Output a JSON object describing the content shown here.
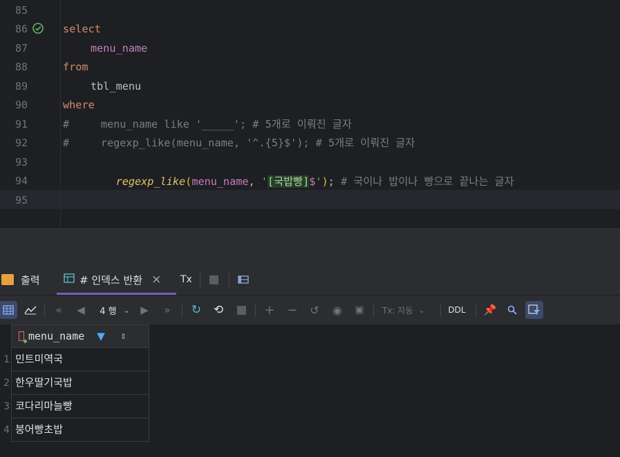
{
  "editor": {
    "line_numbers": [
      "85",
      "86",
      "87",
      "88",
      "89",
      "90",
      "91",
      "92",
      "93",
      "94",
      "95"
    ],
    "lines": {
      "l86": "select",
      "l87": "menu_name",
      "l88": "from",
      "l89": "tbl_menu",
      "l90": "where",
      "l91": "#     menu_name like '_____'; # 5개로 이뤄진 글자",
      "l92": "#     regexp_like(menu_name, '^.{5}$'); # 5개로 이뤄진 글자",
      "l93_fn": "regexp_like",
      "l93_open": "(",
      "l93_col": "menu_name",
      "l93_comma": ", ",
      "l93_q1": "'",
      "l93_regex": "[국밥빵]",
      "l93_end": "$",
      "l93_q2": "'",
      "l93_close": ")",
      "l93_semi": ";",
      "l93_comment": " # 국이나 밥이나 빵으로 끝나는 글자"
    }
  },
  "tabs": {
    "output": "출력",
    "result": "# 인덱스 반환",
    "close": "×",
    "tx": "Tx"
  },
  "toolbar": {
    "rows": "4 행",
    "tx_mode": "Tx: 자동",
    "ddl": "DDL"
  },
  "grid": {
    "column": "menu_name",
    "rows": [
      {
        "num": "1",
        "value": "민트미역국"
      },
      {
        "num": "2",
        "value": "한우딸기국밥"
      },
      {
        "num": "3",
        "value": "코다리마늘빵"
      },
      {
        "num": "4",
        "value": "붕어빵초밥"
      }
    ]
  },
  "colors": {
    "keyword": "#cf8e6d",
    "column": "#c77dbb",
    "comment": "#7a7e85",
    "active_tab": "#7b61b8"
  }
}
